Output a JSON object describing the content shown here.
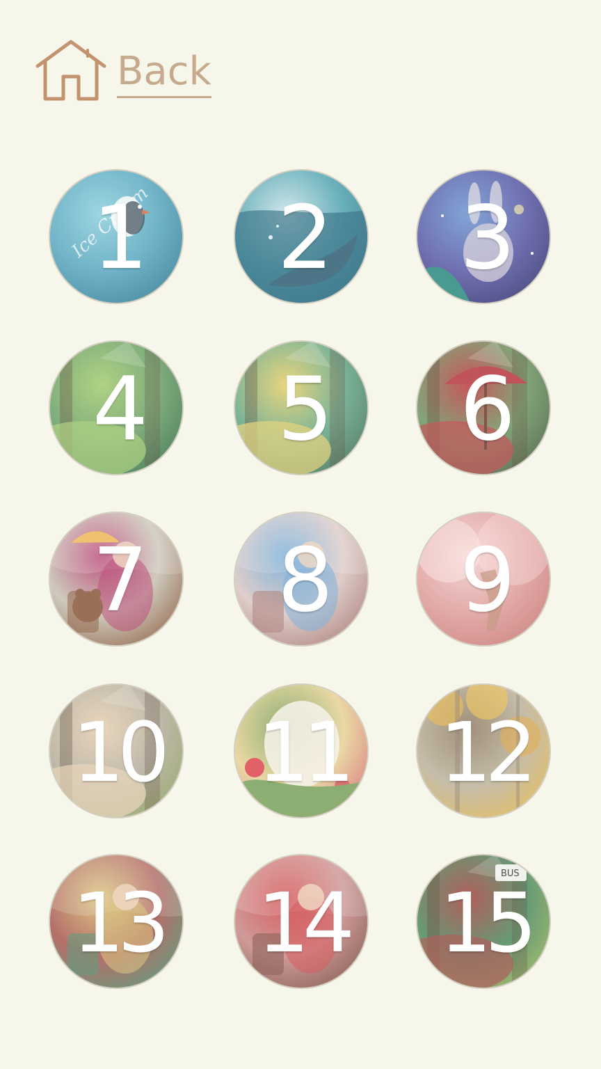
{
  "back": {
    "label": "Back",
    "icon": "home-icon",
    "color": "#c6aa8e"
  },
  "levels": [
    {
      "number": "1",
      "theme": "ice-cream-penguin",
      "colors": [
        "#5aa8c3",
        "#2f7a98",
        "#8fd0e0"
      ]
    },
    {
      "number": "2",
      "theme": "whale-ocean",
      "colors": [
        "#4fa3b2",
        "#2a7188",
        "#c9e4ea"
      ]
    },
    {
      "number": "3",
      "theme": "bunny-night",
      "colors": [
        "#5a5aa9",
        "#313270",
        "#6f98d3"
      ]
    },
    {
      "number": "4",
      "theme": "forest-grass",
      "colors": [
        "#6da16b",
        "#36704a",
        "#a4cc73"
      ]
    },
    {
      "number": "5",
      "theme": "girl-forest",
      "colors": [
        "#67a98a",
        "#3f6d58",
        "#e7cf6d"
      ]
    },
    {
      "number": "6",
      "theme": "umbrella-forest",
      "colors": [
        "#6f9867",
        "#465d40",
        "#bf3d45"
      ]
    },
    {
      "number": "7",
      "theme": "bear-umbrella",
      "colors": [
        "#c8c3b6",
        "#8a5a3f",
        "#b4376c"
      ]
    },
    {
      "number": "8",
      "theme": "princess",
      "colors": [
        "#dbc7c6",
        "#a77773",
        "#6da8d8"
      ]
    },
    {
      "number": "9",
      "theme": "deer-blossom",
      "colors": [
        "#df9f9f",
        "#c97676",
        "#f4d2d1"
      ]
    },
    {
      "number": "10",
      "theme": "bear-trees",
      "colors": [
        "#b6aea0",
        "#8ea062",
        "#e7d1b5"
      ]
    },
    {
      "number": "11",
      "theme": "polar-bear-flowers",
      "colors": [
        "#e8d49a",
        "#d46d70",
        "#7ca260"
      ]
    },
    {
      "number": "12",
      "theme": "golden-leaves",
      "colors": [
        "#bdb49f",
        "#e0b553",
        "#927f68"
      ]
    },
    {
      "number": "13",
      "theme": "girl-room",
      "colors": [
        "#a95955",
        "#4f8c6c",
        "#d9c174"
      ]
    },
    {
      "number": "14",
      "theme": "girl-bench",
      "colors": [
        "#c98b8b",
        "#7b4d45",
        "#d2444a"
      ]
    },
    {
      "number": "15",
      "theme": "bus-stop",
      "colors": [
        "#4f8b63",
        "#95b05b",
        "#a44645"
      ]
    }
  ]
}
